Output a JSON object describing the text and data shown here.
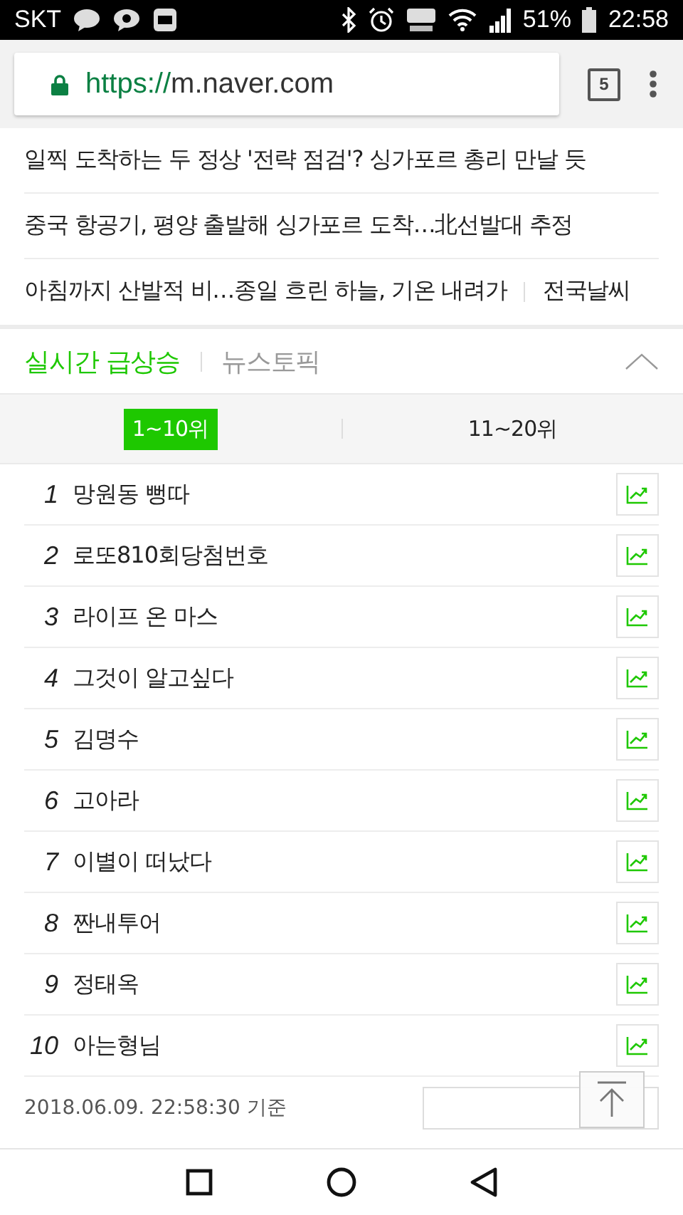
{
  "status_bar": {
    "carrier": "SKT",
    "battery": "51%",
    "time": "22:58"
  },
  "browser": {
    "url_scheme": "https://",
    "url_host": "m.naver.com",
    "tab_count": "5"
  },
  "news": [
    {
      "headline": "일찍 도착하는 두 정상 '전략 점검'? 싱가포르 총리 만날 듯"
    },
    {
      "headline": "중국 항공기, 평양 출발해 싱가포르 도착…北선발대 추정"
    },
    {
      "headline": "아침까지 산발적 비…종일 흐린 하늘, 기온 내려가",
      "link": "전국날씨"
    }
  ],
  "section_tabs": [
    {
      "label": "실시간 급상승",
      "selected": true
    },
    {
      "label": "뉴스토픽",
      "selected": false
    }
  ],
  "range_tabs": [
    {
      "label": "1~10위",
      "selected": true
    },
    {
      "label": "11~20위",
      "selected": false
    }
  ],
  "ranking": [
    {
      "rank": "1",
      "keyword": "망원동 뻥따"
    },
    {
      "rank": "2",
      "keyword": "로또810회당첨번호"
    },
    {
      "rank": "3",
      "keyword": "라이프 온 마스"
    },
    {
      "rank": "4",
      "keyword": "그것이 알고싶다"
    },
    {
      "rank": "5",
      "keyword": "김명수"
    },
    {
      "rank": "6",
      "keyword": "고아라"
    },
    {
      "rank": "7",
      "keyword": "이별이 떠났다"
    },
    {
      "rank": "8",
      "keyword": "짠내투어"
    },
    {
      "rank": "9",
      "keyword": "정태옥"
    },
    {
      "rank": "10",
      "keyword": "아는형님"
    }
  ],
  "footer": {
    "timestamp": "2018.06.09. 22:58:30 기준"
  }
}
